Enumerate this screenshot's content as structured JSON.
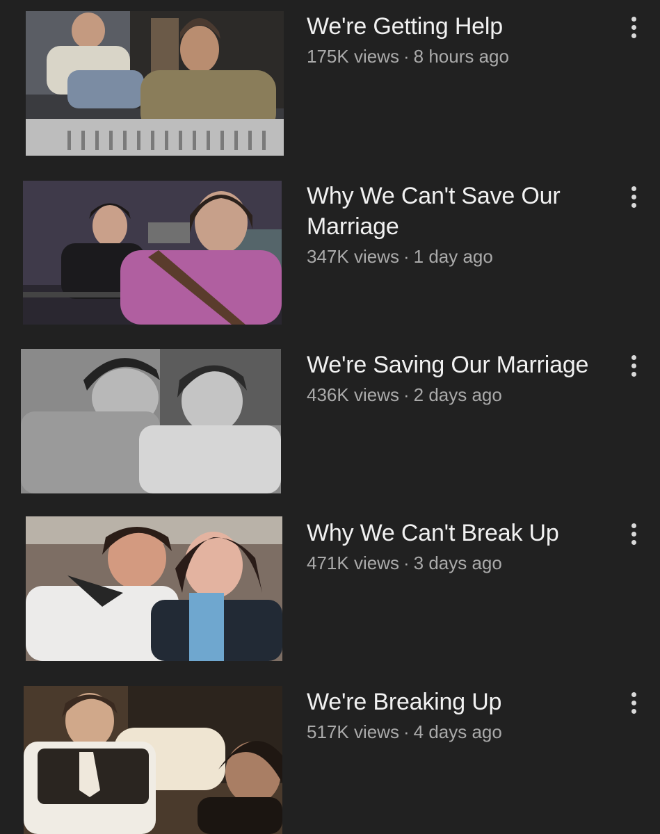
{
  "videos": [
    {
      "title": "We're Getting Help",
      "views": "175K views",
      "separator": "·",
      "age": "8 hours ago",
      "menu_icon": "more-vert-icon"
    },
    {
      "title": "Why We Can't Save Our Marriage",
      "views": "347K views",
      "separator": "·",
      "age": "1 day ago",
      "menu_icon": "more-vert-icon"
    },
    {
      "title": "We're Saving Our Marriage",
      "views": "436K views",
      "separator": "·",
      "age": "2 days ago",
      "menu_icon": "more-vert-icon"
    },
    {
      "title": "Why We Can't Break Up",
      "views": "471K views",
      "separator": "·",
      "age": "3 days ago",
      "menu_icon": "more-vert-icon"
    },
    {
      "title": "We're Breaking Up",
      "views": "517K views",
      "separator": "·",
      "age": "4 days ago",
      "menu_icon": "more-vert-icon"
    }
  ],
  "colors": {
    "background": "#212121",
    "title": "#f1f1f1",
    "meta": "#aaaaaa"
  }
}
